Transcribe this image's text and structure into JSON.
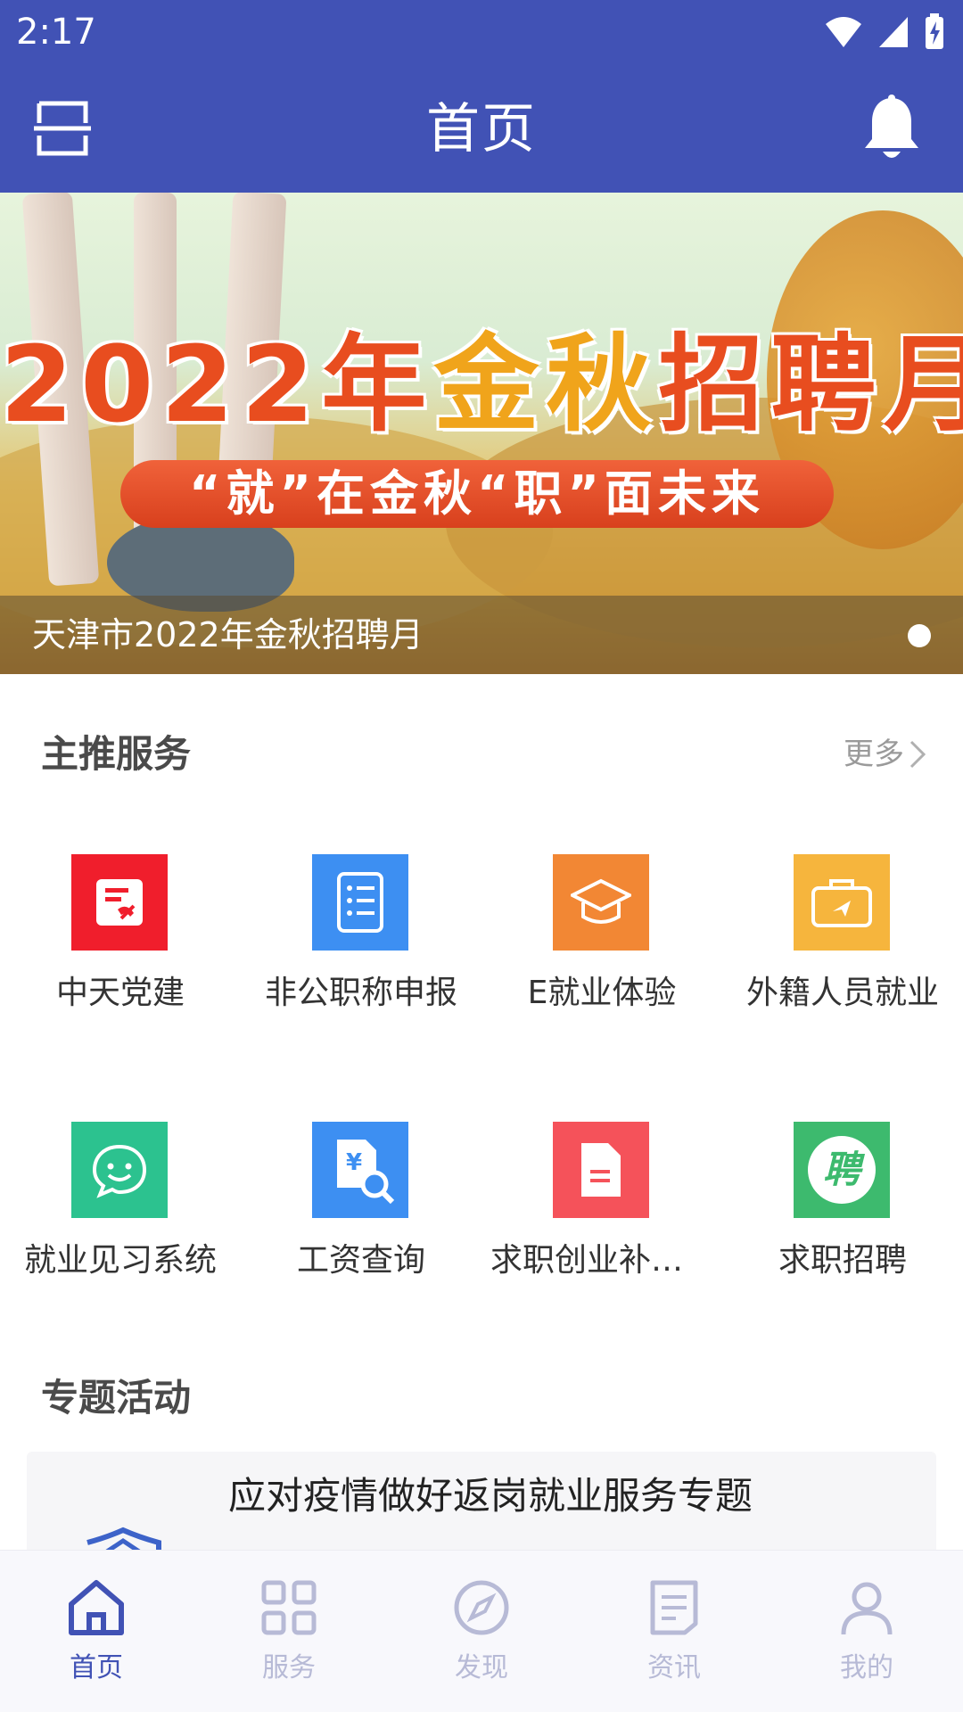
{
  "status_bar": {
    "time": "2:17",
    "icons": [
      "wifi-icon",
      "signal-icon",
      "battery-charging-icon"
    ]
  },
  "header": {
    "title": "首页",
    "left_icon": "scan-icon",
    "right_icon": "bell-icon"
  },
  "banner": {
    "headline_part1": "2022年",
    "headline_part2": "金秋",
    "headline_part3": "招聘月",
    "ribbon": "“就”在金秋“职”面未来",
    "caption": "天津市2022年金秋招聘月",
    "page_indicator": {
      "count": 1,
      "active": 1
    }
  },
  "main_services": {
    "title": "主推服务",
    "more_label": "更多",
    "items": [
      {
        "label": "中天党建",
        "icon": "party-building-icon",
        "color": "#f01e2c"
      },
      {
        "label": "非公职称申报",
        "icon": "checklist-icon",
        "color": "#3d8ff2"
      },
      {
        "label": "E就业体验",
        "icon": "graduation-cap-icon",
        "color": "#f28734"
      },
      {
        "label": "外籍人员就业",
        "icon": "briefcase-icon",
        "color": "#f6b53d"
      },
      {
        "label": "就业见习系统",
        "icon": "chat-smile-icon",
        "color": "#2cc28f"
      },
      {
        "label": "工资查询",
        "icon": "salary-search-icon",
        "color": "#3d8ff2"
      },
      {
        "label": "求职创业补贴...",
        "icon": "document-icon",
        "color": "#f5525a"
      },
      {
        "label": "求职招聘",
        "icon": "recruit-icon",
        "color": "#3dba6e",
        "icon_text": "聘"
      }
    ]
  },
  "topics": {
    "title": "专题活动",
    "card_title": "应对疫情做好返岗就业服务专题"
  },
  "tabbar": {
    "items": [
      {
        "label": "首页",
        "icon": "home-icon",
        "active": true
      },
      {
        "label": "服务",
        "icon": "grid-icon",
        "active": false
      },
      {
        "label": "发现",
        "icon": "compass-icon",
        "active": false
      },
      {
        "label": "资讯",
        "icon": "news-icon",
        "active": false
      },
      {
        "label": "我的",
        "icon": "user-icon",
        "active": false
      }
    ]
  },
  "colors": {
    "primary": "#4152b5",
    "tab_inactive": "#b7bad6"
  }
}
